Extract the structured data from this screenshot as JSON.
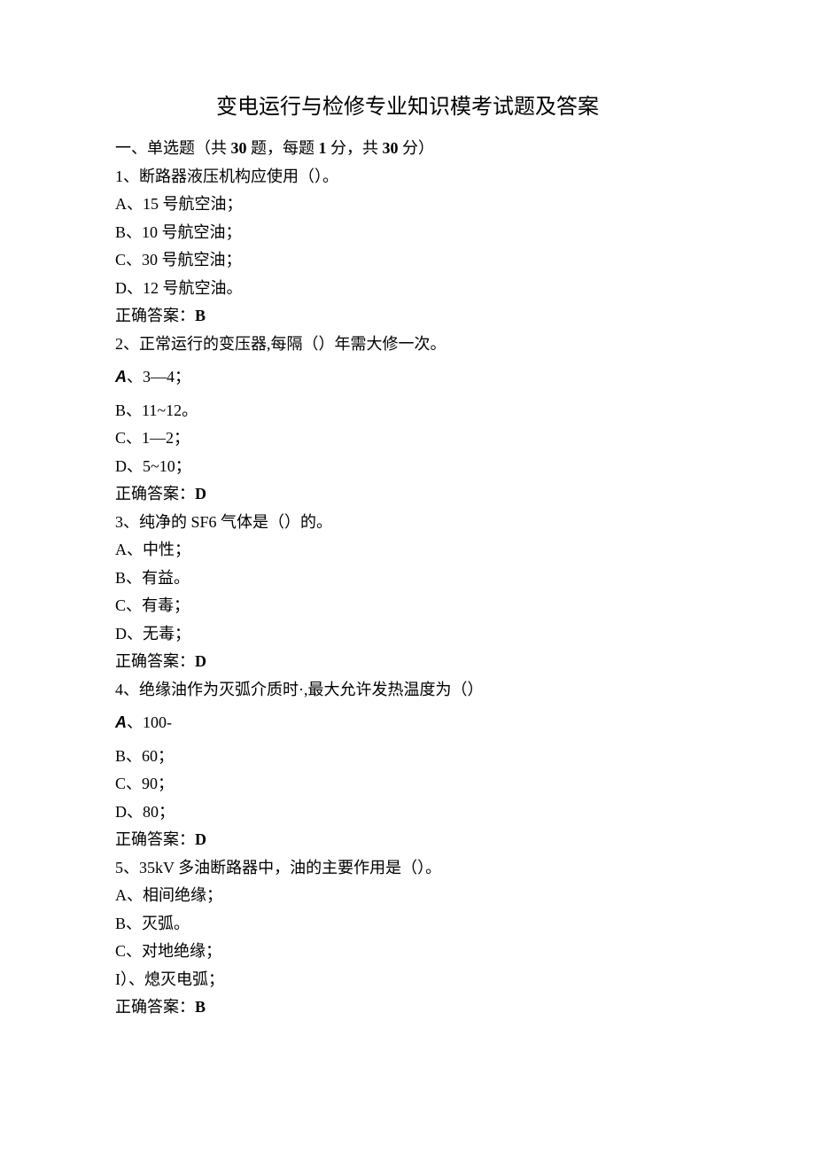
{
  "title": "变电运行与检修专业知识模考试题及答案",
  "section": {
    "prefix": "一、单选题（共 ",
    "count1": "30",
    "mid1": " 题，每题 ",
    "count2": "1",
    "mid2": " 分，共 ",
    "count3": "30",
    "suffix": " 分）"
  },
  "q1": {
    "stem": "1、断路器液压机构应使用（）。",
    "a": "A、15 号航空油；",
    "b": "B、10 号航空油；",
    "c": "C、30 号航空油；",
    "d": "D、12 号航空油。",
    "ans_label": "正确答案：",
    "ans": "B"
  },
  "q2": {
    "stem": "2、正常运行的变压器,每隔（）年需大修一次。",
    "a_prefix": "A",
    "a_rest": "、3—4；",
    "b": "B、11~12。",
    "c": "C、1—2；",
    "d": "D、5~10；",
    "ans_label": "正确答案：",
    "ans": "D"
  },
  "q3": {
    "stem": "3、纯净的 SF6 气体是（）的。",
    "a": "A、中性；",
    "b": "B、有益。",
    "c": "C、有毒；",
    "d": "D、无毒；",
    "ans_label": "正确答案：",
    "ans": "D"
  },
  "q4": {
    "stem": "4、绝缘油作为灭弧介质时·,最大允许发热温度为（）",
    "a_prefix": "A",
    "a_rest": "、100-",
    "b": "B、60；",
    "c": "C、90；",
    "d": "D、80；",
    "ans_label": "正确答案：",
    "ans": "D"
  },
  "q5": {
    "stem": "5、35kV 多油断路器中，油的主要作用是（）。",
    "a": "A、相间绝缘；",
    "b": "B、灭弧。",
    "c": "C、对地绝缘；",
    "d": "I）、熄灭电弧；",
    "ans_label": "正确答案：",
    "ans": "B"
  }
}
